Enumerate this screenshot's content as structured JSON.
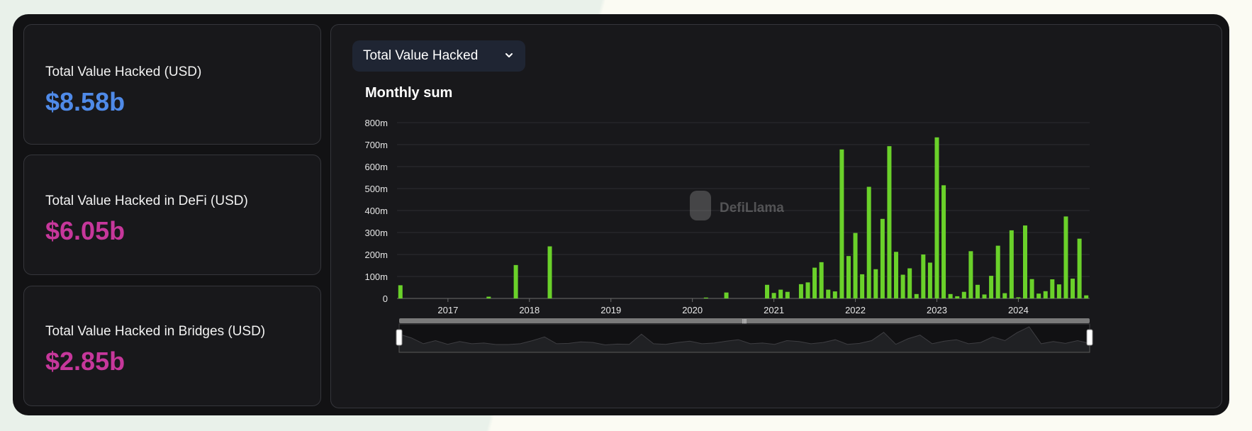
{
  "stats": [
    {
      "label": "Total Value Hacked (USD)",
      "value": "$8.58b",
      "color": "#4f8ae8"
    },
    {
      "label": "Total Value Hacked in DeFi (USD)",
      "value": "$6.05b",
      "color": "#c6379b"
    },
    {
      "label": "Total Value Hacked in Bridges (USD)",
      "value": "$2.85b",
      "color": "#c6379b"
    }
  ],
  "dropdown": {
    "label": "Total Value Hacked"
  },
  "watermark": "DefiLlama",
  "chart_data": {
    "type": "bar",
    "title": "Monthly sum",
    "bar_color": "#6ad12a",
    "start_month": "2016-06",
    "ylim": [
      0,
      800
    ],
    "yticks": [
      {
        "value": 0,
        "label": "0"
      },
      {
        "value": 100,
        "label": "100m"
      },
      {
        "value": 200,
        "label": "200m"
      },
      {
        "value": 300,
        "label": "300m"
      },
      {
        "value": 400,
        "label": "400m"
      },
      {
        "value": 500,
        "label": "500m"
      },
      {
        "value": 600,
        "label": "600m"
      },
      {
        "value": 700,
        "label": "700m"
      },
      {
        "value": 800,
        "label": "800m"
      }
    ],
    "xticks": [
      "2017",
      "2018",
      "2019",
      "2020",
      "2021",
      "2022",
      "2023",
      "2024"
    ],
    "grid": true,
    "values": [
      60,
      0,
      0,
      0,
      0,
      0,
      0,
      0,
      0,
      0,
      0,
      0,
      0,
      8,
      0,
      0,
      0,
      152,
      0,
      0,
      0,
      0,
      237,
      0,
      0,
      0,
      0,
      0,
      0,
      0,
      0,
      0,
      0,
      0,
      0,
      0,
      0,
      0,
      0,
      0,
      0,
      0,
      0,
      0,
      0,
      4,
      0,
      0,
      27,
      0,
      0,
      0,
      0,
      0,
      62,
      25,
      40,
      30,
      0,
      65,
      73,
      140,
      165,
      40,
      32,
      678,
      193,
      298,
      110,
      508,
      133,
      362,
      693,
      212,
      108,
      137,
      20,
      200,
      163,
      733,
      515,
      20,
      10,
      30,
      215,
      62,
      18,
      103,
      240,
      24,
      310,
      5,
      332,
      88,
      22,
      33,
      87,
      64,
      373,
      90,
      272,
      14
    ],
    "navigator_values": [
      60,
      40,
      8,
      25,
      5,
      20,
      8,
      12,
      4,
      4,
      8,
      25,
      45,
      8,
      10,
      18,
      15,
      2,
      6,
      5,
      60,
      8,
      5,
      15,
      22,
      8,
      12,
      22,
      30,
      8,
      12,
      5,
      25,
      20,
      8,
      15,
      30,
      5,
      10,
      25,
      70,
      5,
      35,
      55,
      8,
      22,
      30,
      8,
      15,
      45,
      25,
      68,
      100,
      8,
      20,
      10,
      25,
      10
    ]
  }
}
